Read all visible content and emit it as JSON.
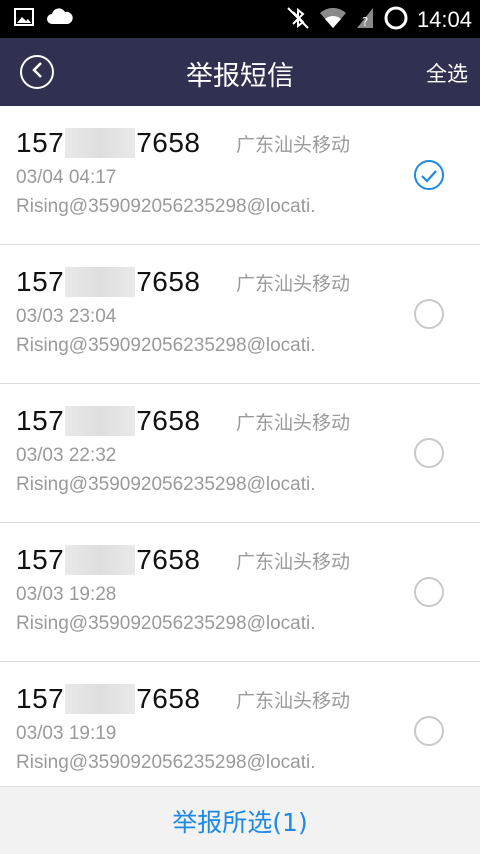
{
  "status_bar": {
    "time": "14:04",
    "icons": [
      "image-icon",
      "cloud-icon",
      "bluetooth-off-icon",
      "wifi-icon",
      "signal-icon",
      "sync-icon"
    ]
  },
  "header": {
    "title": "举报短信",
    "select_all": "全选"
  },
  "messages": [
    {
      "prefix": "157",
      "suffix": "7658",
      "carrier": "广东汕头移动",
      "time": "03/04 04:17",
      "preview": "Rising@359092056235298@locati.",
      "checked": true
    },
    {
      "prefix": "157",
      "suffix": "7658",
      "carrier": "广东汕头移动",
      "time": "03/03 23:04",
      "preview": "Rising@359092056235298@locati.",
      "checked": false
    },
    {
      "prefix": "157",
      "suffix": "7658",
      "carrier": "广东汕头移动",
      "time": "03/03 22:32",
      "preview": "Rising@359092056235298@locati.",
      "checked": false
    },
    {
      "prefix": "157",
      "suffix": "7658",
      "carrier": "广东汕头移动",
      "time": "03/03 19:28",
      "preview": "Rising@359092056235298@locati.",
      "checked": false
    },
    {
      "prefix": "157",
      "suffix": "7658",
      "carrier": "广东汕头移动",
      "time": "03/03 19:19",
      "preview": "Rising@359092056235298@locati.",
      "checked": false
    }
  ],
  "footer": {
    "report_label": "举报所选(1)"
  },
  "colors": {
    "header_bg": "#303150",
    "accent": "#1e88e5"
  }
}
